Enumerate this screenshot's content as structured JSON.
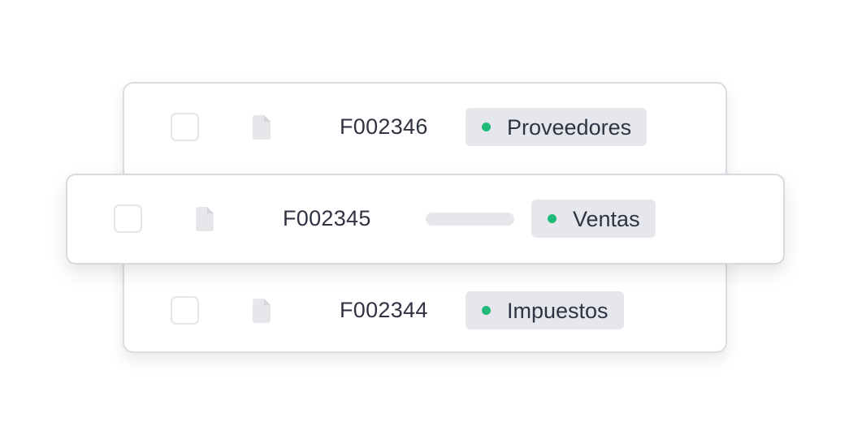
{
  "rows": [
    {
      "code": "F002346",
      "tag": "Proveedores",
      "selected": false,
      "icon": "file-icon"
    },
    {
      "code": "F002345",
      "tag": "Ventas",
      "selected": false,
      "icon": "file-icon",
      "dragging": true
    },
    {
      "code": "F002344",
      "tag": "Impuestos",
      "selected": false,
      "icon": "file-icon"
    }
  ],
  "colors": {
    "tag_background": "#e5e7ec",
    "status_dot": "#1fb978",
    "text": "#2f3342",
    "border": "#dcdde2"
  }
}
